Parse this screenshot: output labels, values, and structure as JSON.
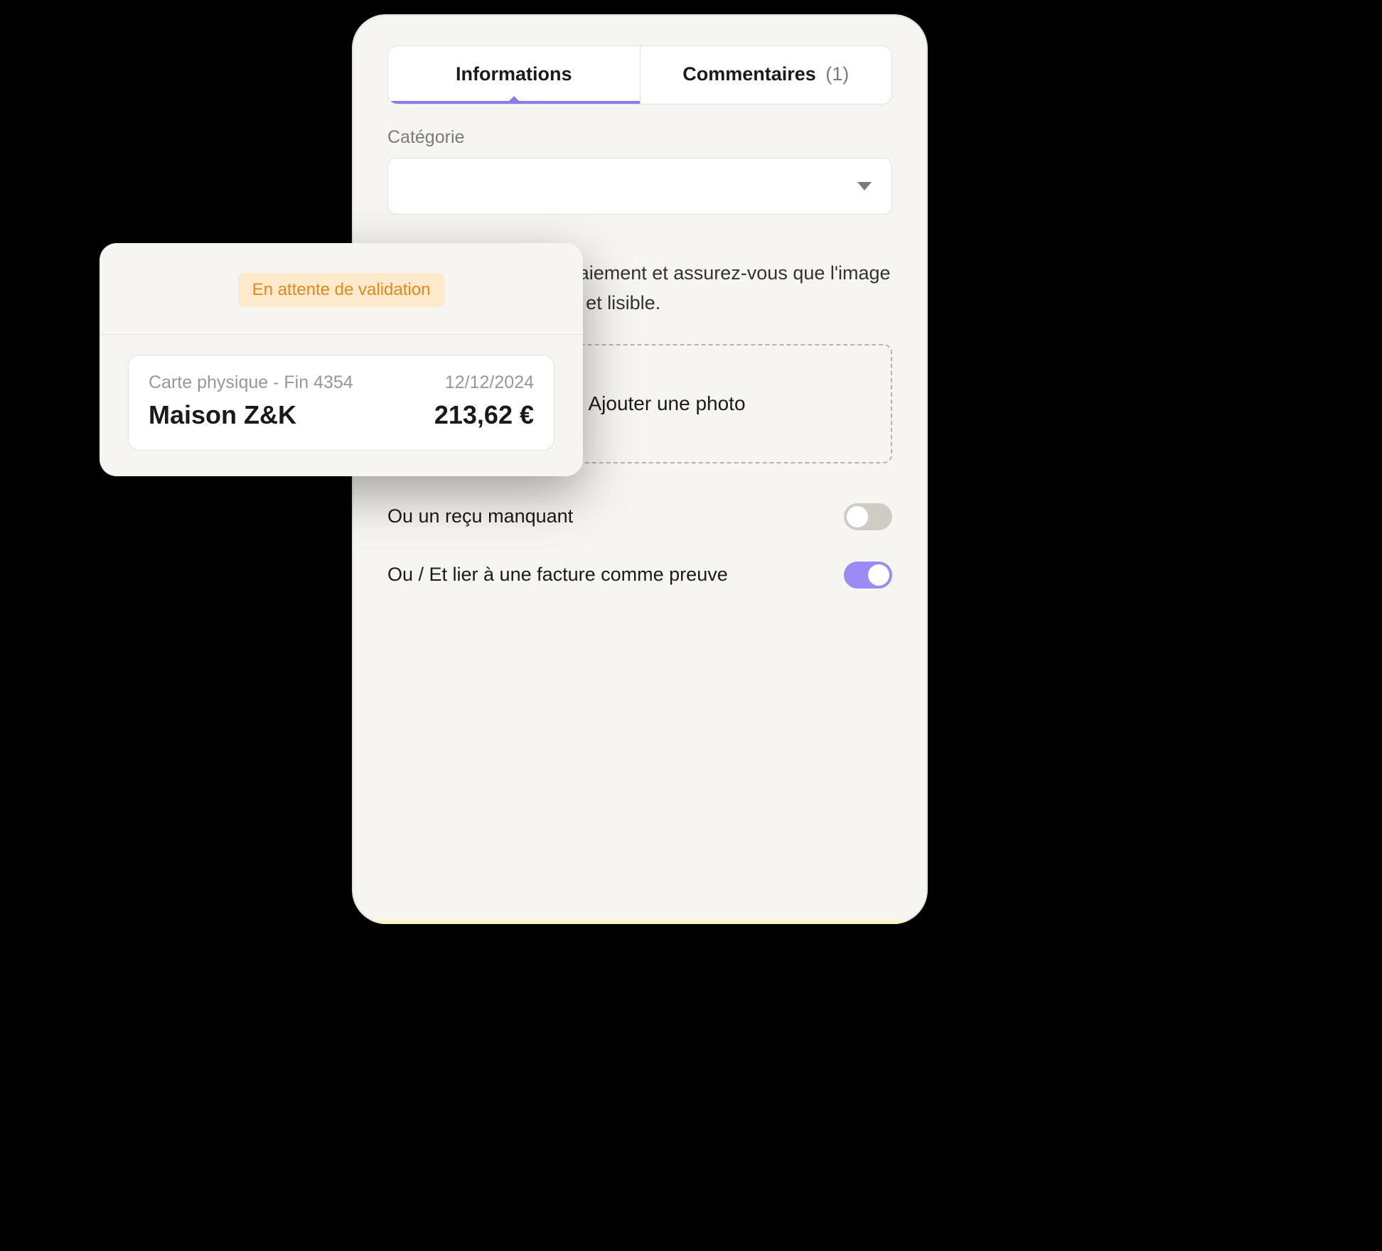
{
  "tabs": {
    "info": "Informations",
    "comments": "Commentaires",
    "comments_count": "(1)"
  },
  "category": {
    "label": "Catégorie"
  },
  "helper_text": "Ajoutez la preuve de paiement et assurez-vous que l'image du document est claire et lisible.",
  "upload": {
    "label": "Ajouter une photo"
  },
  "toggles": {
    "missing_receipt": "Ou un reçu manquant",
    "link_invoice": "Ou / Et lier à une facture comme preuve"
  },
  "popup": {
    "status": "En attente de validation",
    "card_label": "Carte physique - Fin 4354",
    "date": "12/12/2024",
    "merchant": "Maison Z&K",
    "amount": "213,62 €"
  }
}
